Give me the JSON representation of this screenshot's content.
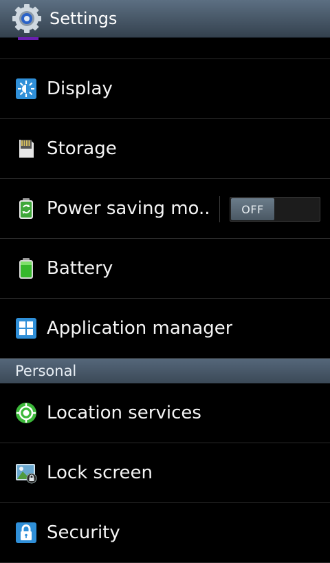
{
  "header": {
    "title": "Settings",
    "icon": "gear-icon"
  },
  "items": [
    {
      "label": "Display",
      "icon": "display-brightness-icon"
    },
    {
      "label": "Storage",
      "icon": "storage-sd-card-icon"
    },
    {
      "label": "Power saving mo..",
      "icon": "power-saving-icon",
      "toggle": "OFF"
    },
    {
      "label": "Battery",
      "icon": "battery-icon"
    },
    {
      "label": "Application manager",
      "icon": "application-manager-icon"
    }
  ],
  "sections": [
    {
      "title": "Personal",
      "items": [
        {
          "label": "Location services",
          "icon": "location-icon"
        },
        {
          "label": "Lock screen",
          "icon": "lock-screen-icon"
        },
        {
          "label": "Security",
          "icon": "security-lock-icon"
        }
      ]
    }
  ],
  "colors": {
    "accent": "#2f8fd8",
    "header": "#4a5b6c",
    "background": "#000000"
  }
}
